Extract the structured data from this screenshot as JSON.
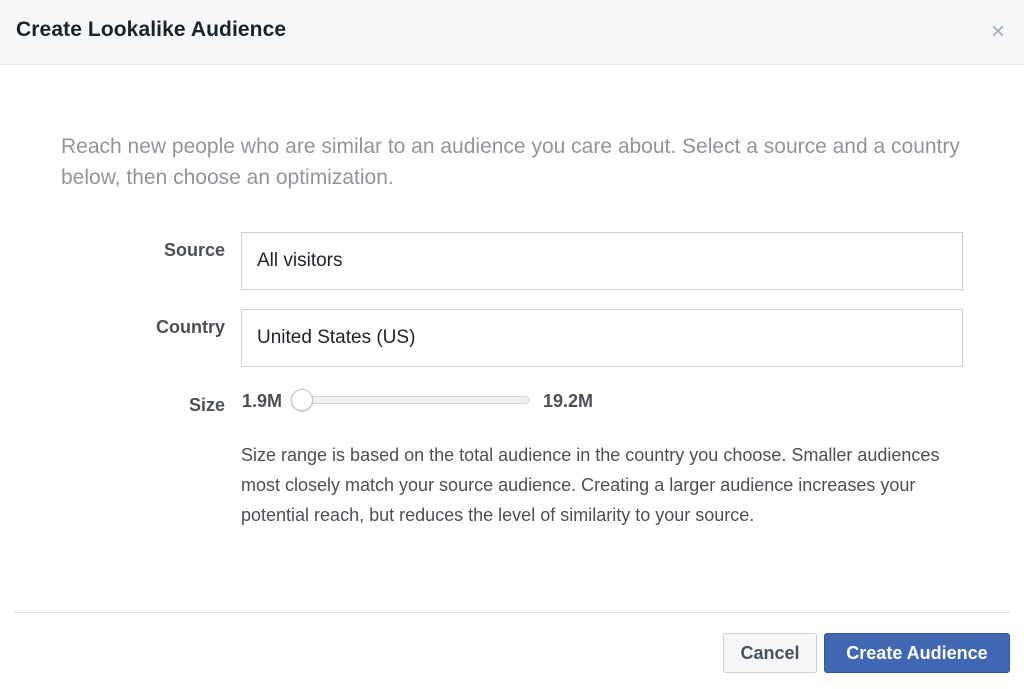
{
  "dialog": {
    "title": "Create Lookalike Audience",
    "close_glyph": "×",
    "intro": "Reach new people who are similar to an audience you care about. Select a source and a country below, then choose an optimization."
  },
  "form": {
    "source_label": "Source",
    "source_value": "All visitors",
    "country_label": "Country",
    "country_value": "United States (US)",
    "size_label": "Size",
    "size_min": "1.9M",
    "size_max": "19.2M",
    "size_selected_fraction": 0,
    "description": "Size range is based on the total audience in the country you choose. Smaller audiences most closely match your source audience. Creating a larger audience increases your potential reach, but reduces the level of similarity to your source."
  },
  "buttons": {
    "cancel": "Cancel",
    "create": "Create Audience"
  },
  "colors": {
    "primary": "#4267b2",
    "header_bg": "#f6f7f9",
    "muted_text": "#90949c"
  },
  "icons": {
    "close": "close-icon"
  }
}
